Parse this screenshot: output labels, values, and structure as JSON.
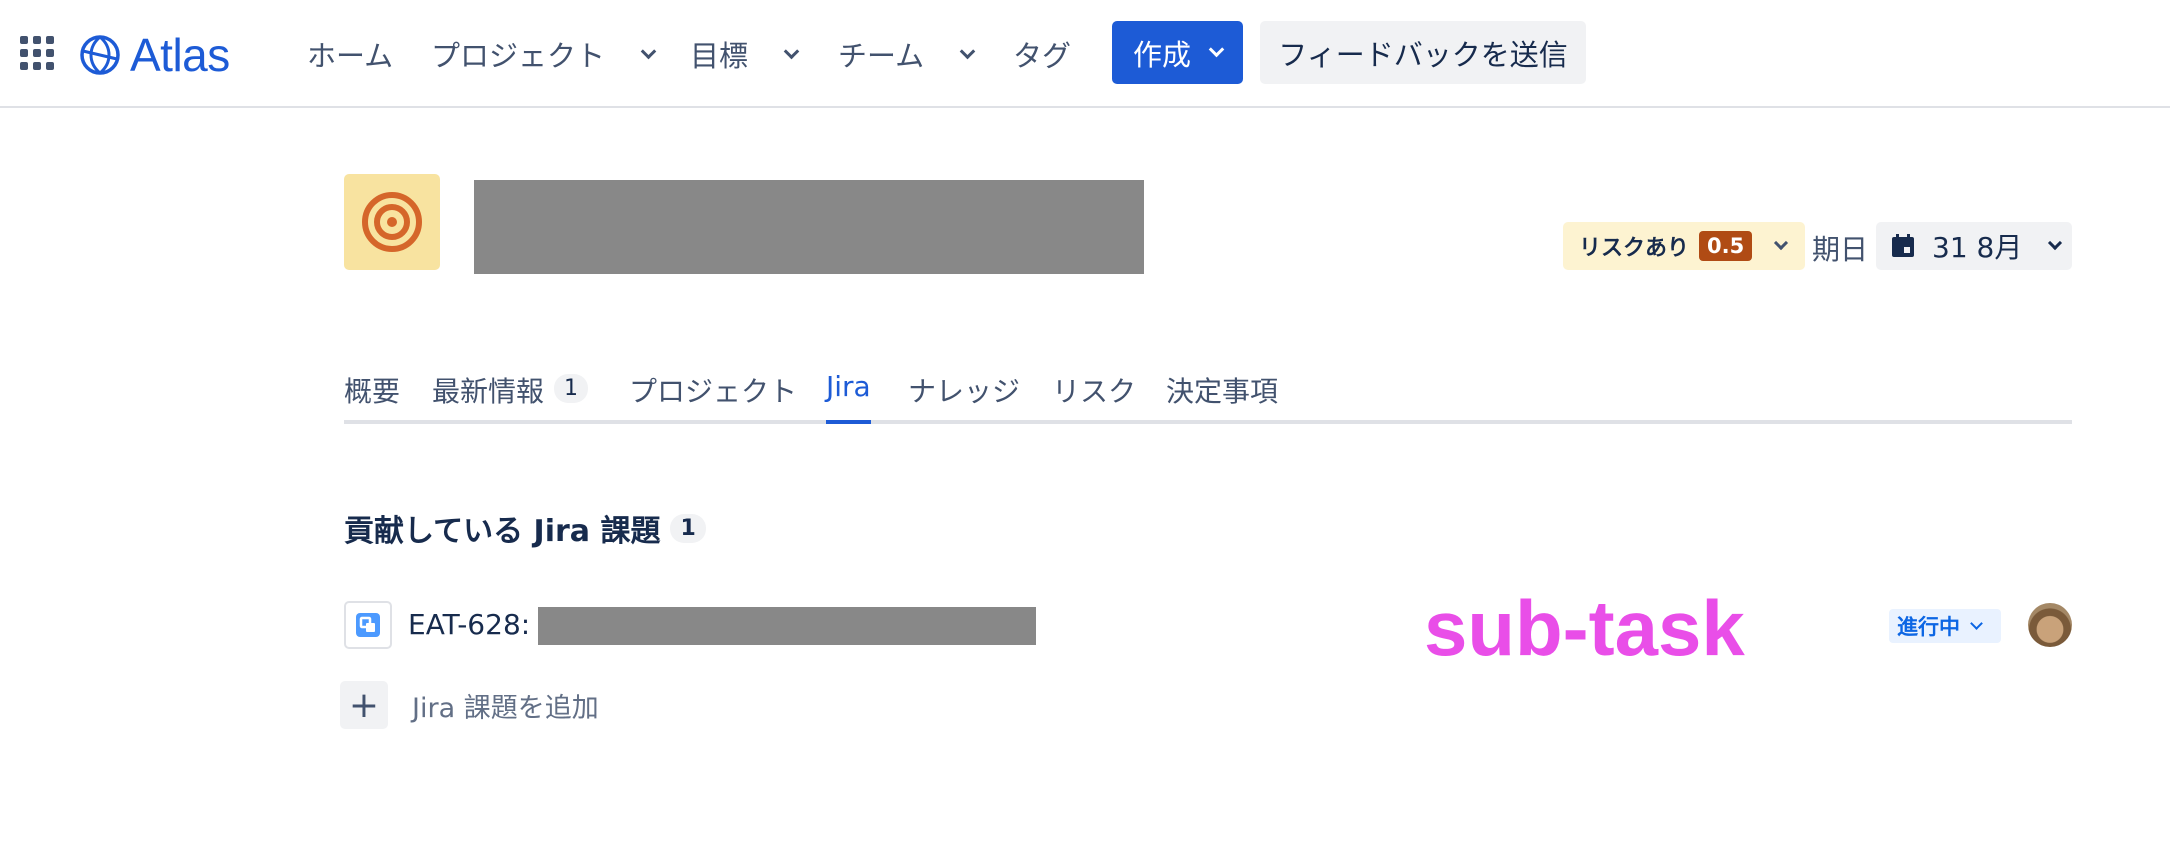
{
  "app": {
    "logo_text": "Atlas",
    "brand_color": "#1d5bd6"
  },
  "nav": {
    "home": "ホーム",
    "projects": "プロジェクト",
    "goals": "目標",
    "teams": "チーム",
    "tags": "タグ",
    "create": "作成",
    "feedback": "フィードバックを送信"
  },
  "goal": {
    "icon": "target-icon",
    "title_redacted": true,
    "risk_label": "リスクあり",
    "risk_score": "0.5",
    "due_label": "期日",
    "due_value": "31 8月"
  },
  "tabs": [
    {
      "label": "概要"
    },
    {
      "label": "最新情報",
      "count": "1"
    },
    {
      "label": "プロジェクト"
    },
    {
      "label": "Jira",
      "active": true
    },
    {
      "label": "ナレッジ"
    },
    {
      "label": "リスク"
    },
    {
      "label": "決定事項"
    }
  ],
  "section": {
    "title": "貢献している Jira 課題",
    "count": "1"
  },
  "issues": [
    {
      "key": "EAT-628:",
      "summary_redacted": true,
      "annotation": "sub-task",
      "status": "進行中"
    }
  ],
  "add_issue_label": "Jira 課題を追加"
}
